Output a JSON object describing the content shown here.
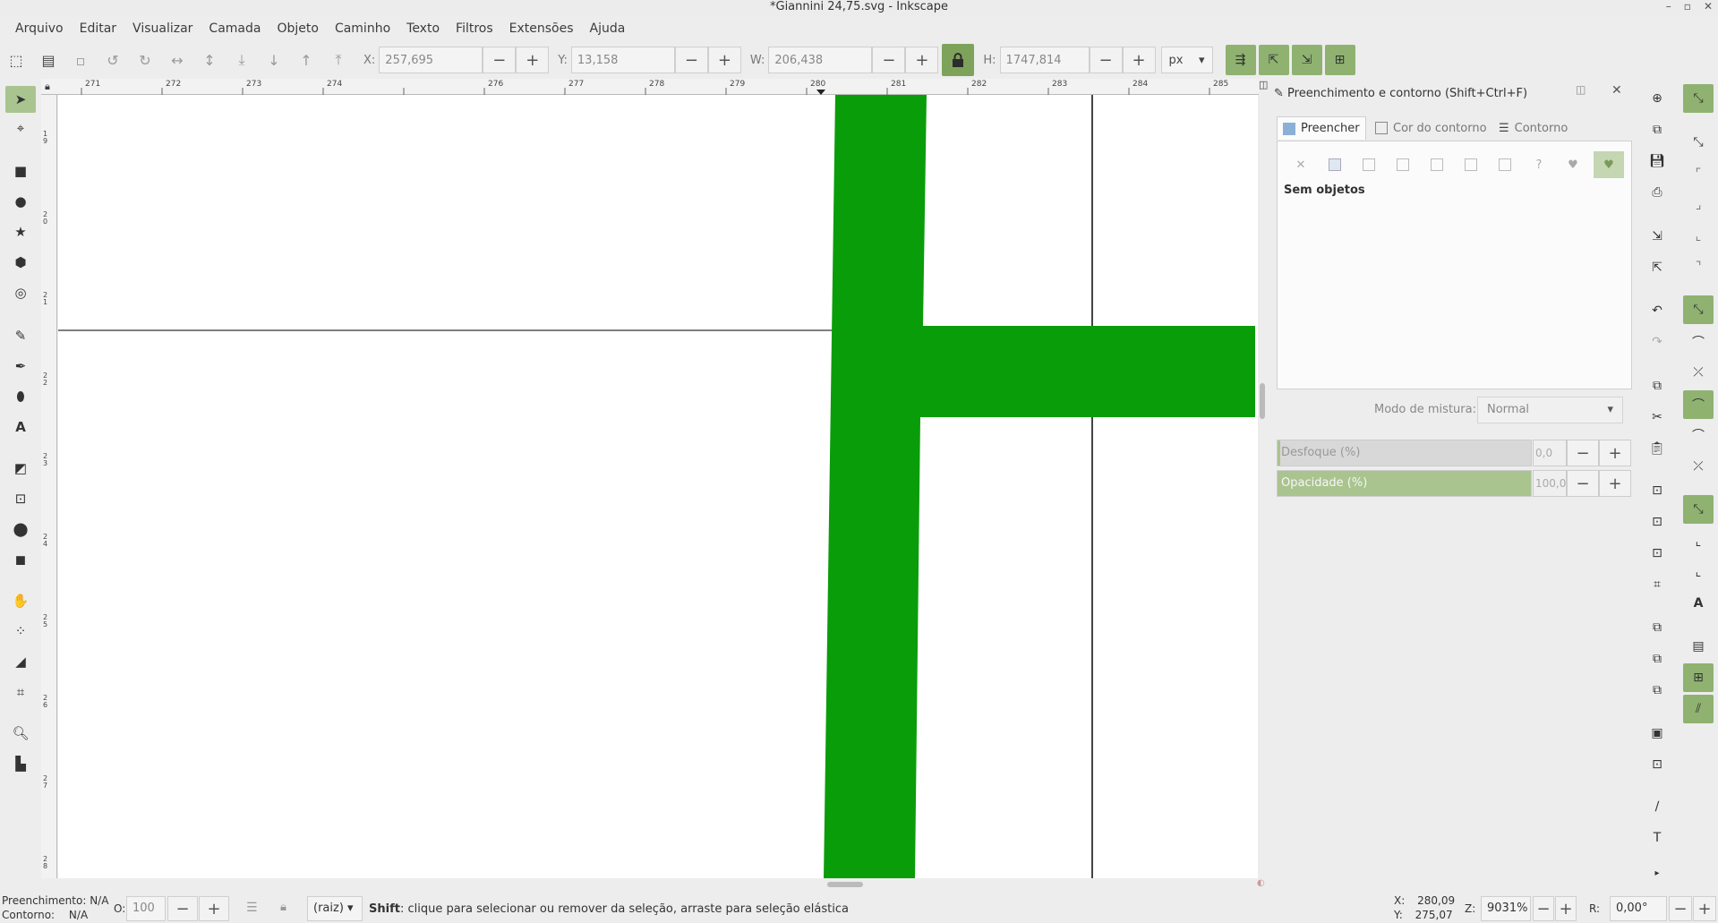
{
  "window": {
    "title": "*Giannini 24,75.svg - Inkscape",
    "minimize": "–",
    "maximize": "▫",
    "close": "✕"
  },
  "menu": [
    "Arquivo",
    "Editar",
    "Visualizar",
    "Camada",
    "Objeto",
    "Caminho",
    "Texto",
    "Filtros",
    "Extensões",
    "Ajuda"
  ],
  "toolbar": {
    "x_label": "X:",
    "x_value": "257,695",
    "y_label": "Y:",
    "y_value": "13,158",
    "w_label": "W:",
    "w_value": "206,438",
    "h_label": "H:",
    "h_value": "1747,814",
    "unit": "px",
    "minus": "−",
    "plus": "+"
  },
  "rulers": {
    "h": [
      "271",
      "272",
      "273",
      "274",
      "276",
      "277",
      "278",
      "279",
      "280",
      "281",
      "282",
      "283",
      "284",
      "285"
    ],
    "v": [
      "1\n9",
      "2\n0",
      "2\n1",
      "2\n2",
      "2\n3",
      "2\n4",
      "2\n5",
      "2\n6",
      "2\n7",
      "2\n8"
    ]
  },
  "panel": {
    "title": "Preenchimento e contorno (Shift+Ctrl+F)",
    "tabs": [
      "Preencher",
      "Cor do contorno",
      "Contorno"
    ],
    "paint_glyphs": [
      "✕",
      "",
      "",
      "",
      "",
      "",
      "",
      "?",
      "",
      ""
    ],
    "no_objects": "Sem objetos",
    "blend_label": "Modo de mistura:",
    "blend_value": "Normal",
    "blur_label": "Desfoque (%)",
    "blur_value": "0,0",
    "blur_fraction": 0.0,
    "opacity_label": "Opacidade (%)",
    "opacity_value": "100,0",
    "opacity_fraction": 1.0
  },
  "status": {
    "fill_label": "Preenchimento:",
    "fill_value": "N/A",
    "stroke_label": "Contorno:",
    "stroke_value": "N/A",
    "opacity_label": "O:",
    "opacity_value": "100",
    "layer": "(raiz)",
    "message_key": "Shift",
    "message": ": clique para selecionar ou remover da seleção, arraste para seleção elástica",
    "cursor_x_label": "X:",
    "cursor_x": "280,09",
    "cursor_y_label": "Y:",
    "cursor_y": "275,07",
    "zoom_label": "Z:",
    "zoom": "9031%",
    "rotation_label": "R:",
    "rotation": "0,00°"
  },
  "colors": {
    "accent": "#8fb271",
    "shape_fill": "#0a9d0a"
  }
}
